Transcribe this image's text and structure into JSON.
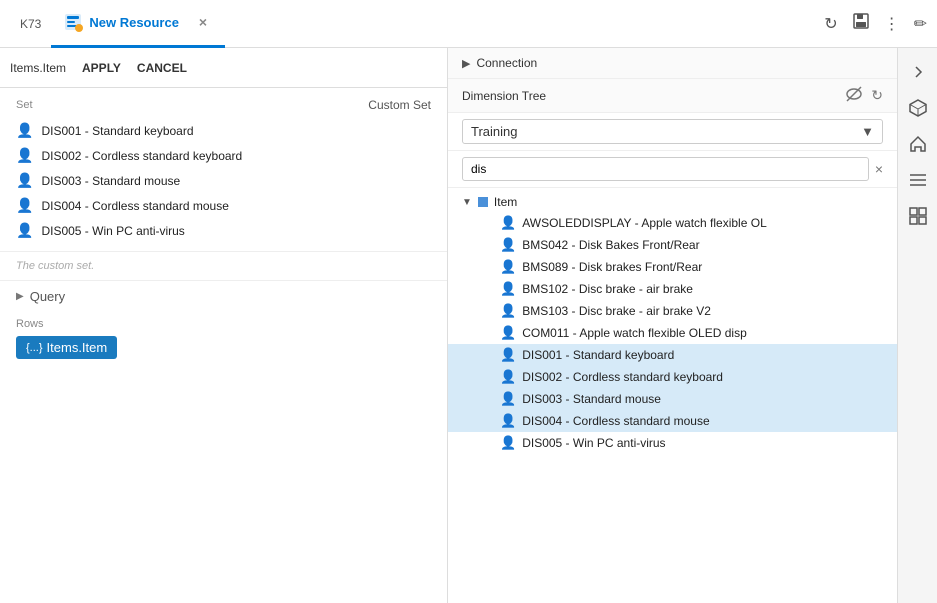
{
  "titleBar": {
    "appLabel": "K73",
    "tabLabel": "New Resource",
    "closeLabel": "×",
    "refreshIcon": "↻",
    "saveIcon": "💾",
    "moreIcon": "⋮",
    "editIcon": "✏"
  },
  "leftPanel": {
    "itemsItemLabel": "Items.Item",
    "applyLabel": "APPLY",
    "cancelLabel": "CANCEL",
    "customSetLabel": "Custom Set",
    "setLabel": "Set",
    "customSetNote": "The custom set.",
    "items": [
      "DIS001 - Standard keyboard",
      "DIS002 - Cordless standard keyboard",
      "DIS003 - Standard mouse",
      "DIS004 - Cordless standard mouse",
      "DIS005 - Win PC anti-virus"
    ],
    "queryLabel": "Query",
    "rowsLabel": "Rows",
    "rowsItem": "{...} Items.Item"
  },
  "rightPanel": {
    "connectionLabel": "Connection",
    "dimensionTreeLabel": "Dimension Tree",
    "hideIcon": "◎",
    "refreshIcon": "↻",
    "dropdownValue": "Training",
    "searchValue": "dis",
    "treeRootLabel": "Item",
    "treeItems": [
      {
        "id": "AWSOLED",
        "label": "AWSOLEDDISPLAY - Apple watch flexible OL",
        "selected": false
      },
      {
        "id": "BMS042",
        "label": "BMS042 - Disk Bakes Front/Rear",
        "selected": false
      },
      {
        "id": "BMS089",
        "label": "BMS089 - Disk brakes Front/Rear",
        "selected": false
      },
      {
        "id": "BMS102",
        "label": "BMS102 - Disc brake - air brake",
        "selected": false
      },
      {
        "id": "BMS103",
        "label": "BMS103 - Disc brake - air brake V2",
        "selected": false
      },
      {
        "id": "COM011",
        "label": "COM011 - Apple watch flexible OLED disp",
        "selected": false
      },
      {
        "id": "DIS001",
        "label": "DIS001 - Standard keyboard",
        "selected": true
      },
      {
        "id": "DIS002",
        "label": "DIS002 - Cordless standard keyboard",
        "selected": true
      },
      {
        "id": "DIS003",
        "label": "DIS003 - Standard mouse",
        "selected": true
      },
      {
        "id": "DIS004",
        "label": "DIS004 - Cordless standard mouse",
        "selected": true
      },
      {
        "id": "DIS005",
        "label": "DIS005 - Win PC anti-virus",
        "selected": false
      }
    ]
  },
  "sideIcons": {
    "chevronRight": ">",
    "cubeIcon": "⬡",
    "homeIcon": "⌂",
    "listIcon": "≡",
    "gridIcon": "⊞"
  }
}
